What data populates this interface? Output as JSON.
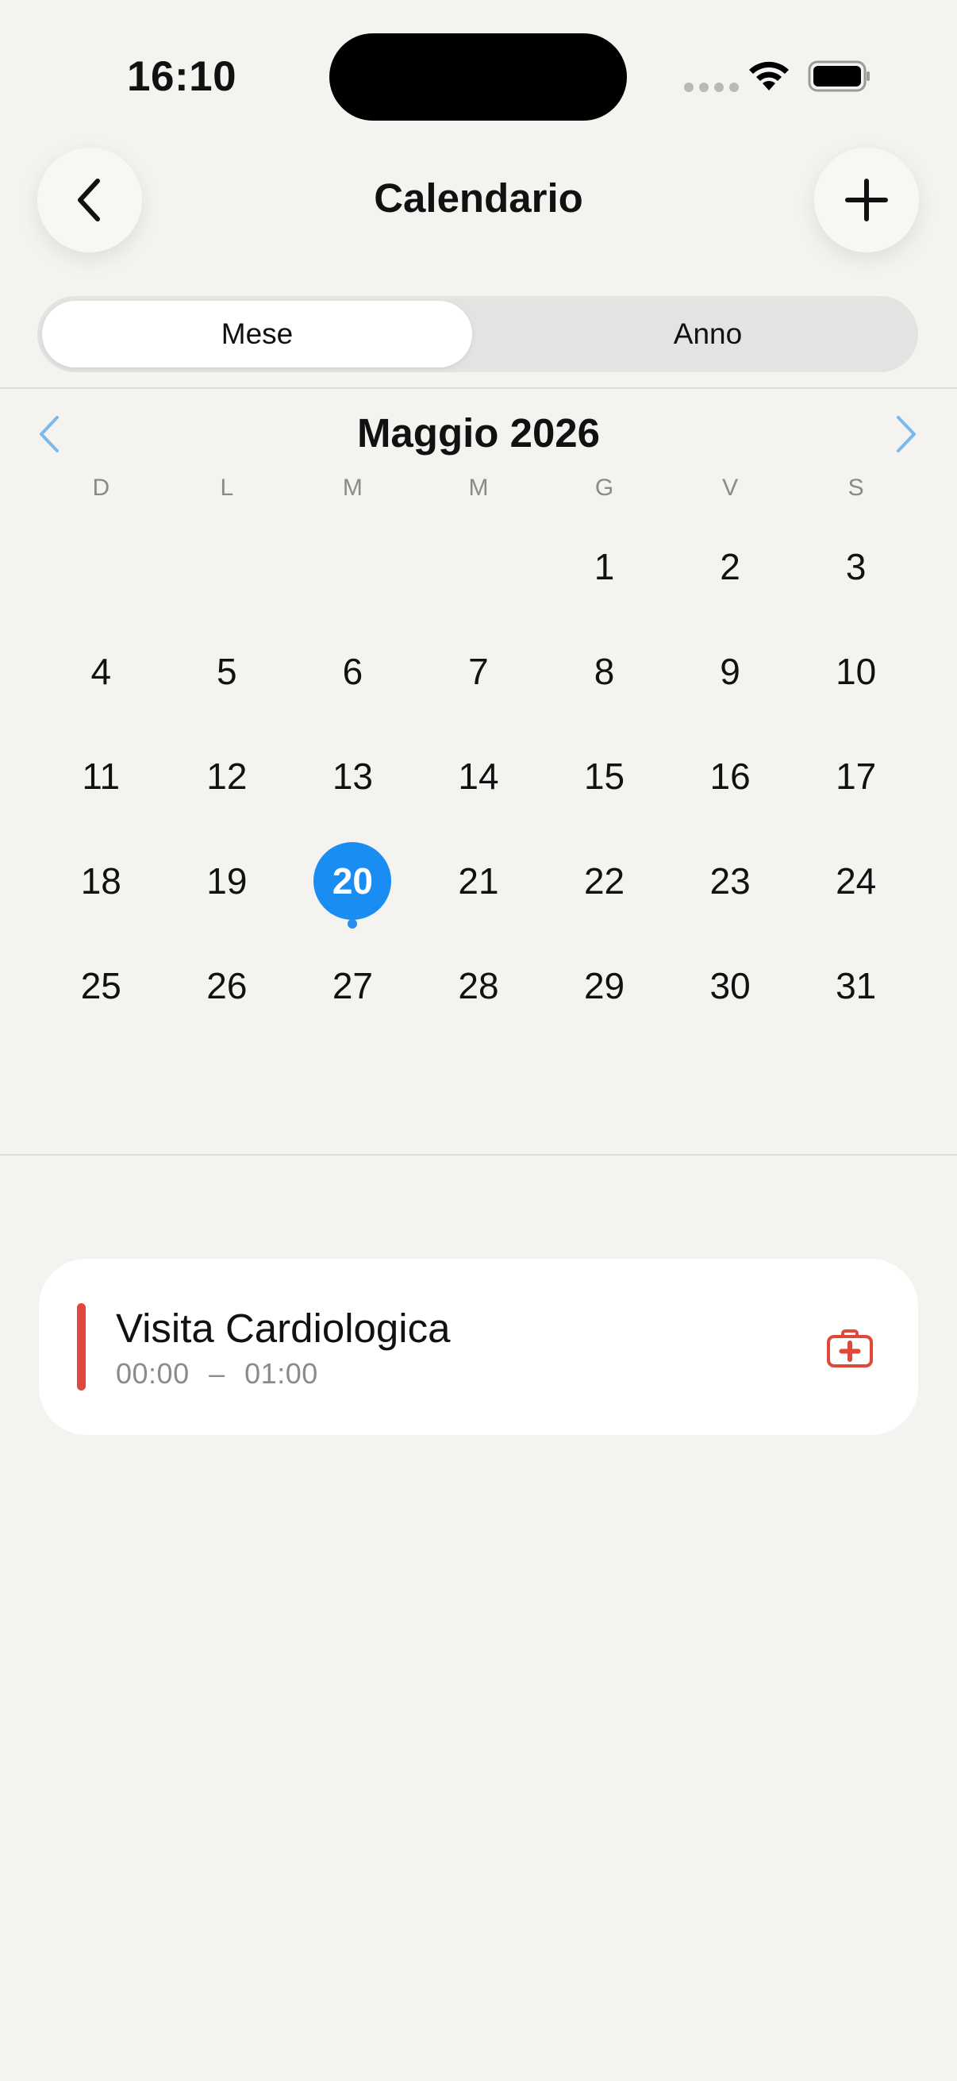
{
  "status": {
    "time": "16:10"
  },
  "header": {
    "title": "Calendario"
  },
  "segmented": {
    "month_label": "Mese",
    "year_label": "Anno",
    "selected": "Mese"
  },
  "calendar": {
    "month_title": "Maggio 2026",
    "weekdays": [
      "D",
      "L",
      "M",
      "M",
      "G",
      "V",
      "S"
    ],
    "days": [
      "",
      "",
      "",
      "",
      "1",
      "2",
      "3",
      "4",
      "5",
      "6",
      "7",
      "8",
      "9",
      "10",
      "11",
      "12",
      "13",
      "14",
      "15",
      "16",
      "17",
      "18",
      "19",
      "20",
      "21",
      "22",
      "23",
      "24",
      "25",
      "26",
      "27",
      "28",
      "29",
      "30",
      "31"
    ],
    "selected_day": "20",
    "days_with_events": [
      "20"
    ]
  },
  "event": {
    "title": "Visita Cardiologica",
    "start": "00:00",
    "separator": "–",
    "end": "01:00",
    "color": "#e0483c",
    "icon": "medical-kit-icon"
  },
  "colors": {
    "accent": "#1a8df2",
    "event_red": "#e0483c",
    "background": "#f4f3f0"
  }
}
